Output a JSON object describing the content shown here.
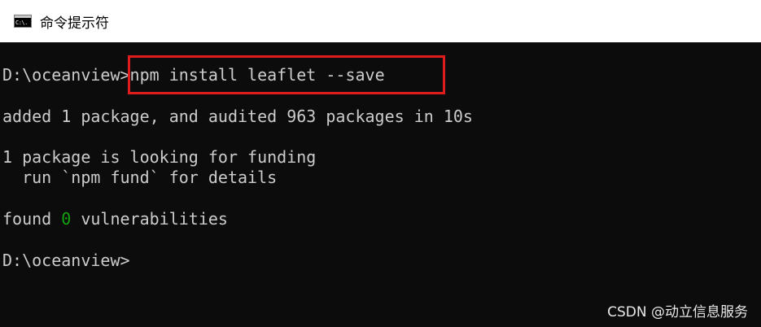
{
  "window": {
    "title": "命令提示符",
    "icon": "cmd-icon",
    "icon_glyph": "C:\\."
  },
  "console": {
    "prompt1": "D:\\oceanview>",
    "command": "npm install leaflet --save",
    "line_added": "added 1 package, and audited 963 packages in 10s",
    "line_funding": "1 package is looking for funding",
    "line_fund_hint": "  run `npm fund` for details",
    "found_prefix": "found ",
    "found_count": "0",
    "found_suffix": " vulnerabilities",
    "prompt2": "D:\\oceanview>"
  },
  "annotation": {
    "highlight_color": "#e01b1b"
  },
  "watermark": {
    "text": "CSDN @动立信息服务"
  },
  "colors": {
    "console_bg": "#0c0c0c",
    "console_text": "#cccccc",
    "success_green": "#13a10e"
  }
}
